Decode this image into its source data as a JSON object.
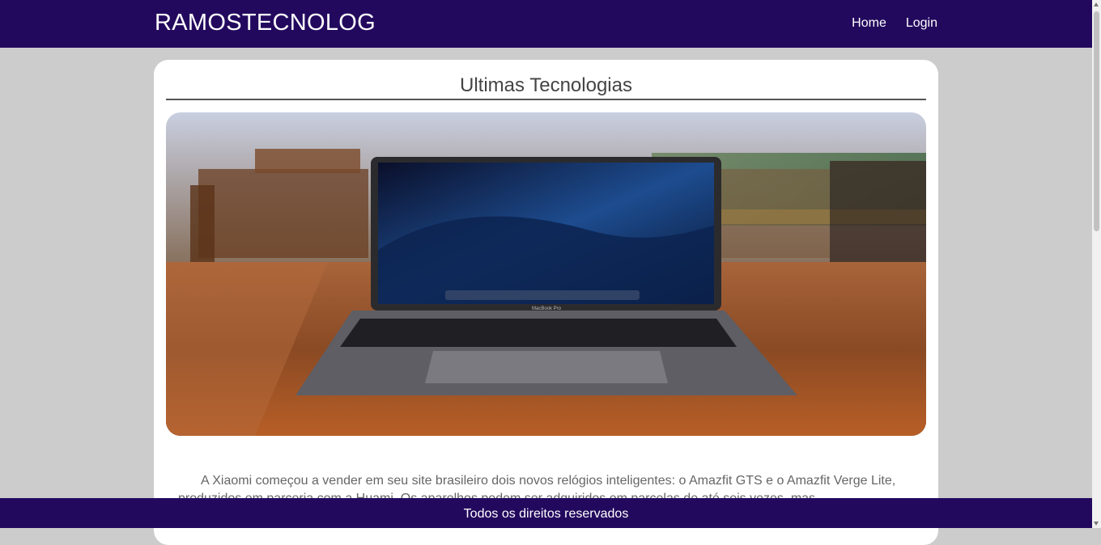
{
  "navbar": {
    "brand": "RAMOSTECNOLOG",
    "links": [
      "Home",
      "Login"
    ]
  },
  "main": {
    "title": "Ultimas Tecnologias",
    "hero_image_icon": "laptop-on-table-photo",
    "laptop_label": "MacBook Pro",
    "article_text": "A Xiaomi começou a vender em seu site brasileiro dois novos relógios inteligentes: o Amazfit GTS e o Amazfit Verge Lite, produzidos em parceria com a Huami. Os aparelhos podem ser adquiridos em parcelas de até seis vezes, mas"
  },
  "footer": {
    "text": "Todos os direitos reservados"
  },
  "colors": {
    "nav_bg": "#23095e",
    "page_bg": "#cccccc",
    "card_bg": "#ffffff"
  }
}
